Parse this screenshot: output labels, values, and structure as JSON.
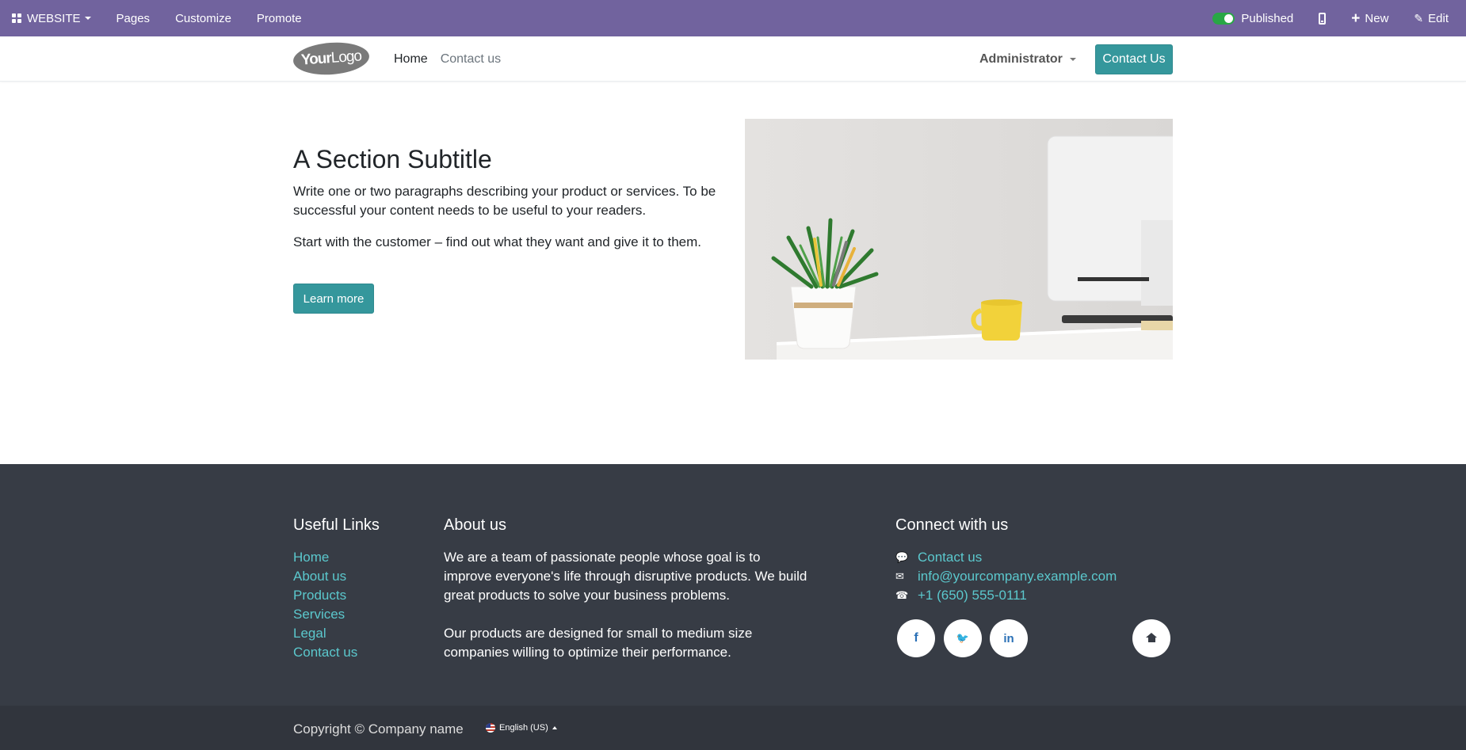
{
  "admin_bar": {
    "website_label": "WEBSITE",
    "pages_label": "Pages",
    "customize_label": "Customize",
    "promote_label": "Promote",
    "published_label": "Published",
    "new_label": "New",
    "edit_label": "Edit",
    "publish_toggle_on": true
  },
  "header": {
    "logo_text_bold": "Your",
    "logo_text_light": "Logo",
    "nav": [
      {
        "label": "Home",
        "active": true
      },
      {
        "label": "Contact us",
        "active": false
      }
    ],
    "user_menu_label": "Administrator",
    "cta_label": "Contact Us"
  },
  "hero": {
    "title": "A Section Subtitle",
    "paragraph1": "Write one or two paragraphs describing your product or services. To be successful your content needs to be useful to your readers.",
    "paragraph2": "Start with the customer – find out what they want and give it to them.",
    "button_label": "Learn more"
  },
  "footer": {
    "useful_links_title": "Useful Links",
    "useful_links": [
      "Home",
      "About us",
      "Products",
      "Services",
      "Legal",
      "Contact us"
    ],
    "about_title": "About us",
    "about_p1": "We are a team of passionate people whose goal is to improve everyone's life through disruptive products. We build great products to solve your business problems.",
    "about_p2": "Our products are designed for small to medium size companies willing to optimize their performance.",
    "connect_title": "Connect with us",
    "contact_link": "Contact us",
    "email": "info@yourcompany.example.com",
    "phone": "+1 (650) 555-0111",
    "social_facebook": "f",
    "social_twitter": "🐦",
    "social_linkedin": "in",
    "copyright": "Copyright © Company name",
    "language": "English (US)"
  },
  "colors": {
    "admin_bar": "#71639e",
    "primary": "#35979c",
    "footer_bg": "#373c45",
    "footer_link": "#5bc8cd"
  }
}
